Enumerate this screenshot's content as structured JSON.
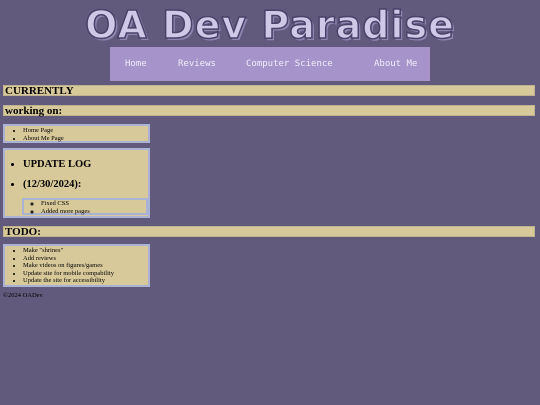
{
  "site": {
    "title": "OA Dev Paradise"
  },
  "nav": {
    "items": [
      {
        "label": "Home"
      },
      {
        "label": "Reviews"
      },
      {
        "label": "Computer Science"
      },
      {
        "label": "About Me"
      }
    ]
  },
  "sections": {
    "currently": "CURRENTLY",
    "working_on": "working on:",
    "working_items": [
      "Home Page",
      "About Me Page"
    ],
    "update_log_title": "UPDATE LOG",
    "update_date": "(12/30/2024):",
    "update_items": [
      "Fixed CSS",
      "Added more pages"
    ],
    "todo": "TODO:",
    "todo_items": [
      "Make \"shrines\"",
      "Add reviews",
      "Make videos on figures/games",
      "Update site for mobile compability",
      "Update the site for accessibility"
    ]
  },
  "footer": {
    "text": "©2024 OADev"
  },
  "colors": {
    "background": "#615a7c",
    "nav": "#a593c9",
    "panel": "#d7c99a",
    "panel_border": "#aab3d6"
  }
}
